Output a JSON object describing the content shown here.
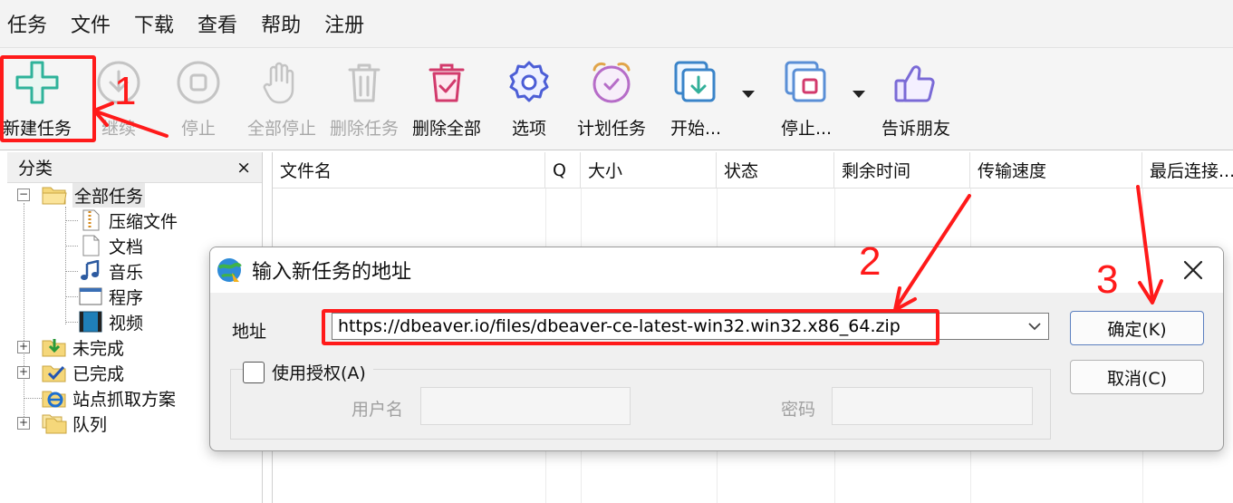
{
  "menu": [
    "任务",
    "文件",
    "下载",
    "查看",
    "帮助",
    "注册"
  ],
  "toolbar": {
    "new_task": "新建任务",
    "resume": "继续",
    "stop": "停止",
    "stop_all": "全部停止",
    "delete_task": "删除任务",
    "delete_all": "删除全部",
    "options": "选项",
    "scheduler": "计划任务",
    "start_queue": "开始...",
    "stop_queue": "停止...",
    "tell_friend": "告诉朋友"
  },
  "sidebar": {
    "title": "分类",
    "close": "×",
    "tree": {
      "all": "全部任务",
      "compressed": "压缩文件",
      "documents": "文档",
      "music": "音乐",
      "programs": "程序",
      "video": "视频",
      "unfinished": "未完成",
      "finished": "已完成",
      "grabber": "站点抓取方案",
      "queues": "队列"
    }
  },
  "list": {
    "columns": [
      "文件名",
      "Q",
      "大小",
      "状态",
      "剩余时间",
      "传输速度",
      "最后连接..."
    ]
  },
  "dialog": {
    "title": "输入新任务的地址",
    "address_label": "地址",
    "url": "https://dbeaver.io/files/dbeaver-ce-latest-win32.win32.x86_64.zip",
    "ok": "确定(K)",
    "cancel": "取消(C)",
    "use_auth": "使用授权(A)",
    "username_label": "用户名",
    "password_label": "密码"
  },
  "annotations": [
    "1",
    "2",
    "3"
  ],
  "colors": {
    "annotation": "#ff1a1a",
    "accent": "#2b6fd6"
  }
}
